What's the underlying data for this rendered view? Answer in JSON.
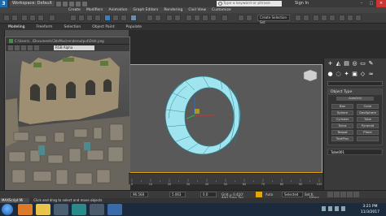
{
  "titlebar": {
    "workspace": "Workspace: Default",
    "search_placeholder": "Type a keyword or phrase",
    "signin": "Sign In"
  },
  "menu": [
    "Create",
    "Modifiers",
    "Animation",
    "Graph Editors",
    "Rendering",
    "Civil View",
    "Customize"
  ],
  "toolbar": {
    "selection_set": "Create Selection Set"
  },
  "ribbon": {
    "tabs": [
      "Modeling",
      "Freeform",
      "Selection",
      "Object Paint",
      "Populate"
    ]
  },
  "material_window": {
    "title": "C:\\Users\\...\\Documents\\3dsMax\\renderoutput\\Dskt.png",
    "channel": "RGB Alpha"
  },
  "command_panel": {
    "rollout_title": "Object Type",
    "autogrid": "AutoGrid",
    "buttons": [
      "Box",
      "Cone",
      "Sphere",
      "GeoSphere",
      "Cylinder",
      "Tube",
      "Torus",
      "Pyramid",
      "Teapot",
      "Plane",
      "TextPlus",
      ""
    ],
    "object_name": "Tube001"
  },
  "timeline": {
    "ticks": [
      "0",
      "10",
      "20",
      "30",
      "40",
      "50",
      "60",
      "70",
      "80",
      "90",
      "100"
    ]
  },
  "status": {
    "x_value": "96.568",
    "y_value": "5.063",
    "z_value": "0.0",
    "grid": "Grid = 0.410'",
    "add_time_tag": "Add Time Tag",
    "auto": "Auto",
    "selected": "Selected",
    "set_k": "Set K.",
    "filters": "Filters..."
  },
  "prompt": {
    "script_label": "MAXScript Mi",
    "message": "Click and drag to select and move objects"
  },
  "taskbar": {
    "time": "3:21 PM",
    "date": "11/3/2017"
  },
  "colors": {
    "tube": "#6fd6e8",
    "viewport_border": "#e0a800",
    "accent": "#3a7fc2"
  }
}
